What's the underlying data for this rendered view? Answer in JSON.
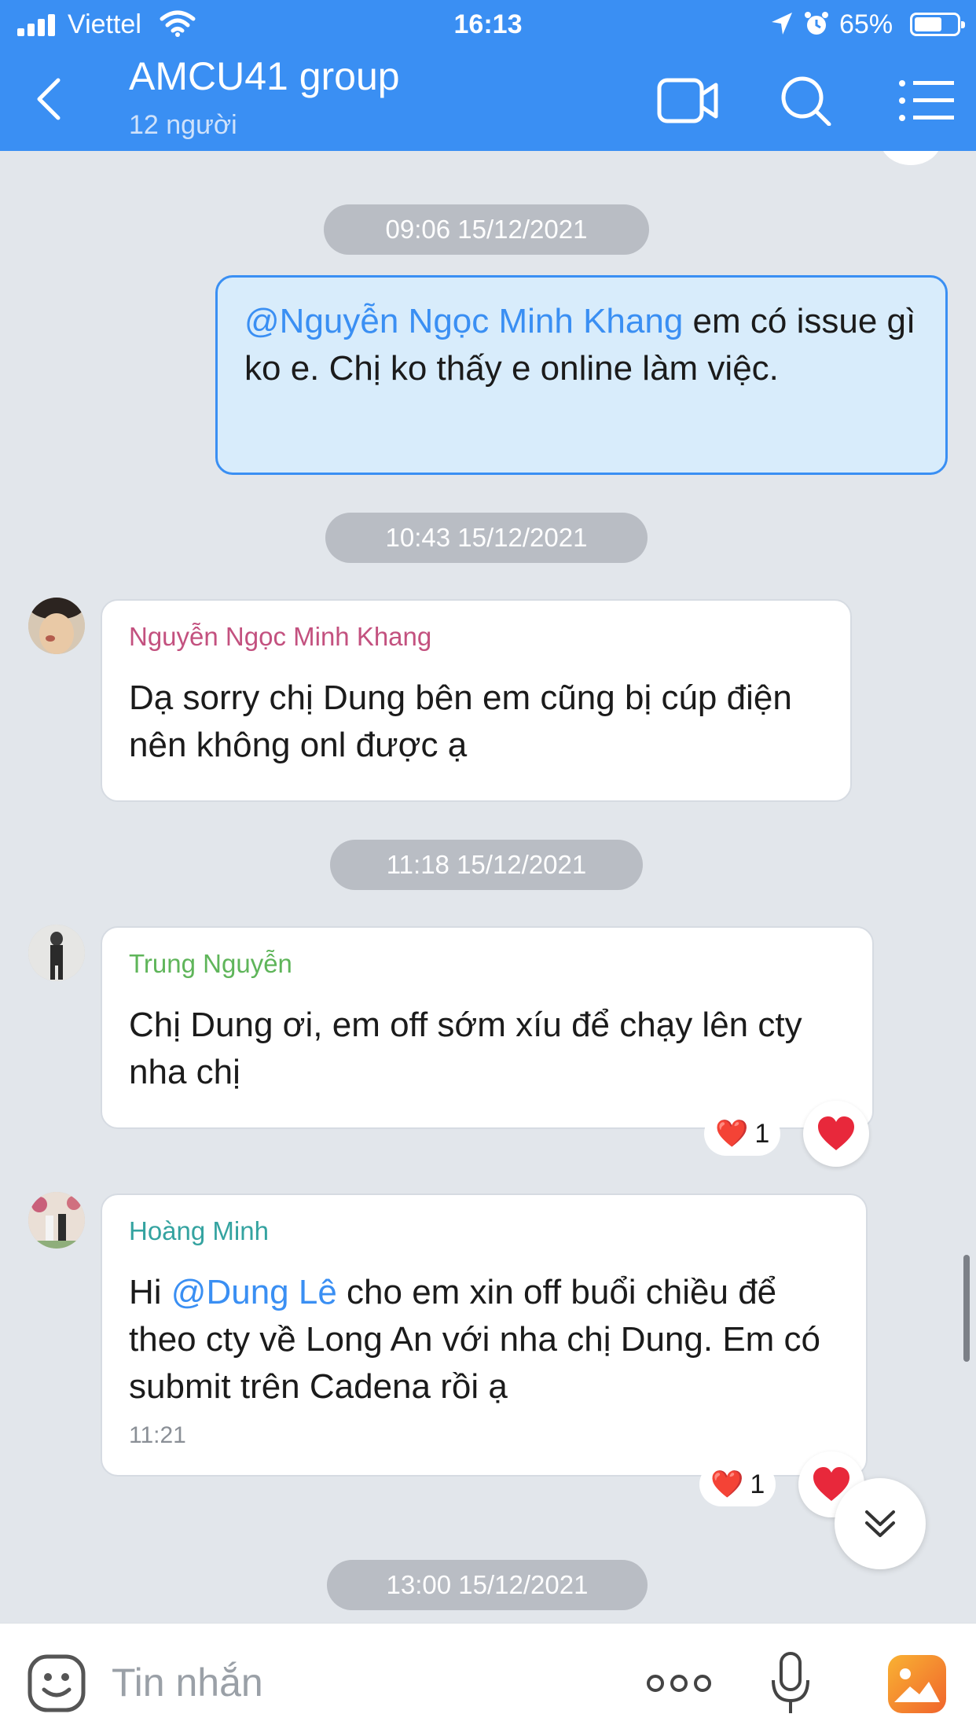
{
  "status_bar": {
    "carrier": "Viettel",
    "time": "16:13",
    "battery_percent": "65%",
    "battery_level": 0.65
  },
  "header": {
    "title": "AMCU41 group",
    "subtitle": "12 người",
    "color": "#3a8ff3"
  },
  "messages": [
    {
      "date": "09:06 15/12/2021"
    },
    {
      "own": true,
      "mention": "@Nguyễn Ngọc Minh Khang",
      "text": " em có issue gì ko e. Chị ko thấy e online làm việc."
    },
    {
      "date": "10:43 15/12/2021"
    },
    {
      "sender": "Nguyễn Ngọc Minh Khang",
      "sender_color": "#c3517f",
      "text": "Dạ sorry chị Dung bên em cũng bị cúp điện nên không onl được ạ"
    },
    {
      "date": "11:18 15/12/2021"
    },
    {
      "sender": "Trung Nguyễn",
      "sender_color": "#5fb55a",
      "text": "Chị Dung ơi, em off sớm xíu để chạy lên cty nha chị",
      "reaction": "❤️",
      "reaction_count": "1"
    },
    {
      "sender": "Hoàng Minh",
      "sender_color": "#34a3a0",
      "text_before": "Hi ",
      "mention": "@Dung Lê",
      "text": "  cho em xin off buổi chiều để theo cty về Long An với nha chị Dung. Em có submit trên Cadena rồi ạ",
      "time": "11:21",
      "reaction": "❤️",
      "reaction_count": "1"
    },
    {
      "date": "13:00 15/12/2021"
    }
  ],
  "composer": {
    "placeholder": "Tin nhắn"
  },
  "icons": {
    "back": "chevron-left-icon",
    "video": "video-camera-icon",
    "search": "search-icon",
    "menu": "list-menu-icon",
    "emoji": "emoji-icon",
    "more": "more-dots-icon",
    "mic": "microphone-icon",
    "photo": "photo-icon",
    "scroll_down": "double-chevron-down-icon"
  }
}
